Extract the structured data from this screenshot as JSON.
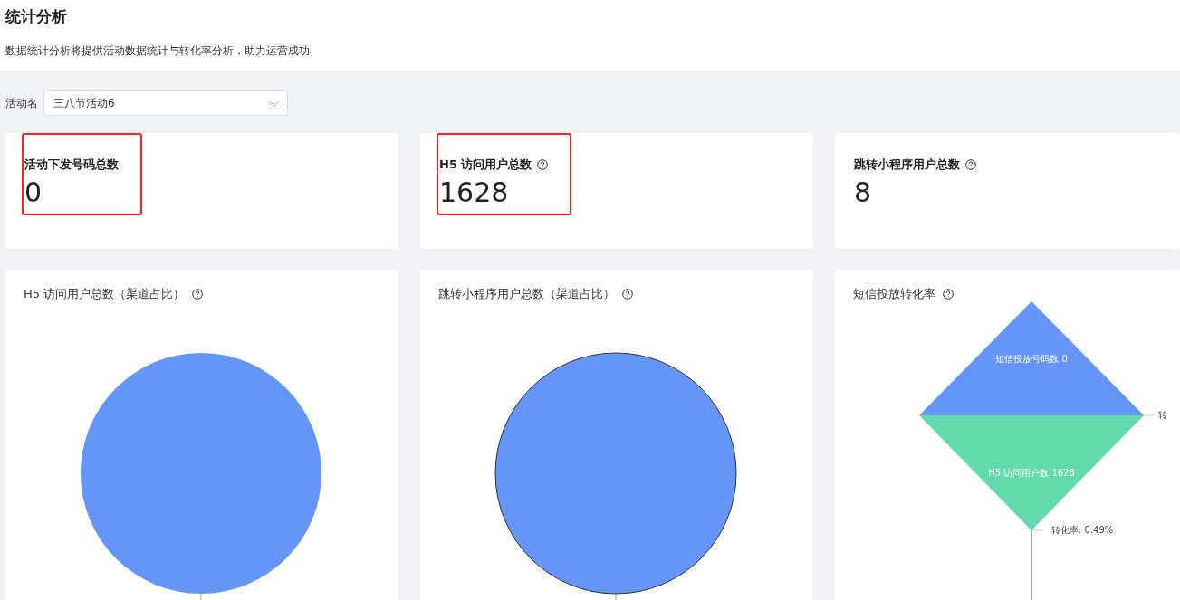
{
  "page": {
    "title": "统计分析",
    "description": "数据统计分析将提供活动数据统计与转化率分析，助力运营成功"
  },
  "filter": {
    "label": "活动名",
    "value": "三八节活动6"
  },
  "stats": [
    {
      "title": "活动下发号码总数",
      "help": false,
      "value": "0",
      "highlighted": true
    },
    {
      "title": "H5 访问用户总数",
      "help": true,
      "value": "1628",
      "highlighted": true
    },
    {
      "title": "跳转小程序用户总数",
      "help": true,
      "value": "8",
      "highlighted": false
    }
  ],
  "charts": [
    {
      "kind": "pie",
      "title": "H5 访问用户总数（渠道占比）",
      "help": true,
      "outlined": false
    },
    {
      "kind": "pie",
      "title": "跳转小程序用户总数（渠道占比）",
      "help": true,
      "outlined": true
    },
    {
      "kind": "funnel",
      "title": "短信投放转化率",
      "help": true,
      "stages": [
        {
          "label": "短信投放号码数 0",
          "color": "#6495f9"
        },
        {
          "label": "H5 访问用户数 1628",
          "color": "#63daab"
        }
      ],
      "side_label": "转",
      "bottom_label": "转化率: 0.49%"
    }
  ]
}
